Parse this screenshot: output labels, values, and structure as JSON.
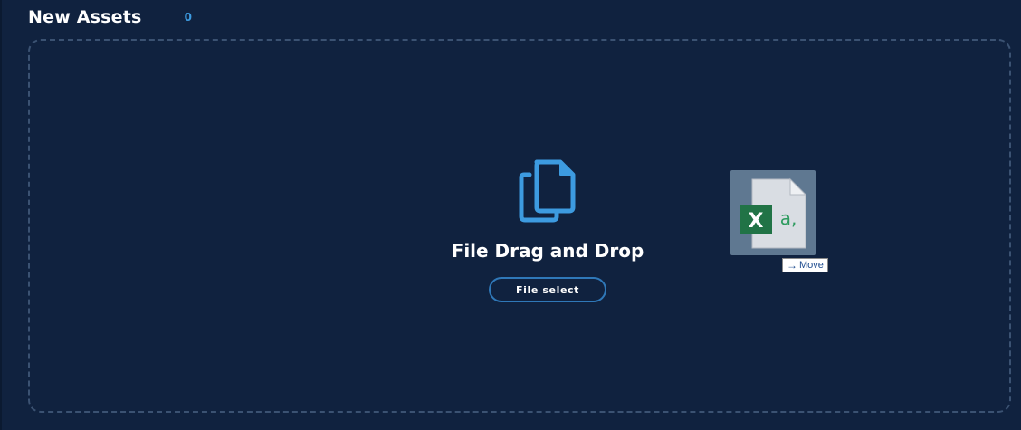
{
  "header": {
    "title": "New Assets",
    "count": "0"
  },
  "dropzone": {
    "title": "File Drag and Drop",
    "file_select_label": "File select",
    "icon": "copy-files-icon"
  },
  "drag_preview": {
    "icon": "excel-file-icon",
    "excel_letter": "X",
    "file_glyph": "a,",
    "tooltip": {
      "arrow": "→",
      "label": "Move"
    }
  },
  "colors": {
    "background": "#10223f",
    "accent": "#3d9be0",
    "dashed_border": "#3b5272",
    "button_border": "#2f78b8",
    "excel_green": "#217346"
  }
}
